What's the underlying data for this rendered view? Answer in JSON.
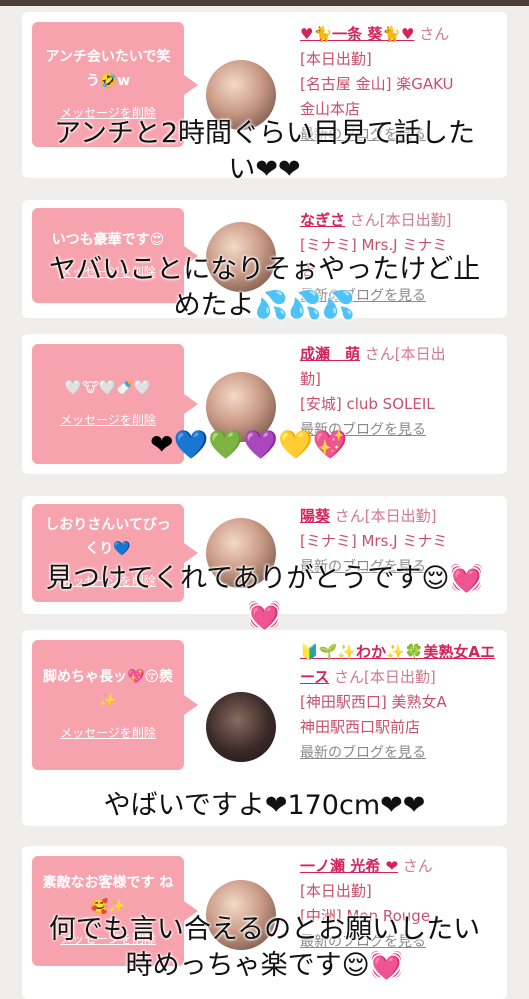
{
  "cards": [
    {
      "message": "アンチ会いたいで笑う🤣w",
      "delete_label": "メッセージを削除",
      "name": "♥🐈一条 葵🐈♥",
      "san": "さん",
      "lines": [
        "[本日出勤]",
        "[名古屋 金山] 楽GAKU",
        "金山本店"
      ],
      "blog": "最新のブログを見る"
    },
    {
      "message": "いつも豪華です😍",
      "delete_label": "メッセージを削除",
      "name": "なぎさ",
      "san": "さん[本日出勤]",
      "lines": [
        "[ミナミ] Mrs.J ミナミ",
        "店"
      ],
      "blog": "最新のブログを見る"
    },
    {
      "message": "🤍🐮🤍🍼🤍",
      "delete_label": "メッセージを削除",
      "name": "成瀬　萌",
      "san": "さん[本日出",
      "lines": [
        "勤]",
        "[安城] club SOLEIL"
      ],
      "blog": "最新のブログを見る"
    },
    {
      "message": "しおりさんいてびっくり💙",
      "delete_label": "メッセージを削除",
      "name": "陽葵",
      "san": "さん[本日出勤]",
      "lines": [
        "[ミナミ] Mrs.J ミナミ"
      ],
      "blog": "最新のブログを見る"
    },
    {
      "message": "脚めちゃ長ッ💖😚羨✨",
      "delete_label": "メッセージを削除",
      "name": "🔰🌱✨わか✨🍀美熟女Aエース",
      "san": "さん[本日出勤]",
      "lines": [
        "[神田駅西口] 美熟女A",
        "神田駅西口駅前店"
      ],
      "blog": "最新のブログを見る"
    },
    {
      "message": "素敵なお客様です ね🥰✨",
      "delete_label": "メッセージを削除",
      "name": "一ノ瀬 光希 ❤",
      "san": "さん",
      "lines": [
        "[本日出勤]",
        "[中洲] Mon Rouge"
      ],
      "blog": "最新のブログを見る"
    }
  ],
  "overlays": [
    "アンチと2時間ぐらい目見て話した",
    "い❤❤",
    "ヤバいことになりそぉやったけど止",
    "めたよ💦💦💦",
    "❤💙💚💜💛💖",
    "見つけてくれてありがとうです😌💓",
    "💓",
    "やばいですよ❤170cm❤❤",
    "何でも言い合えるのとお願いしたい",
    "時めっちゃ楽です😌💓"
  ],
  "colors": {
    "bubble": "#f7a3ae",
    "name": "#d4235a",
    "shop": "#c8506a",
    "topbar": "#4e3d36"
  }
}
